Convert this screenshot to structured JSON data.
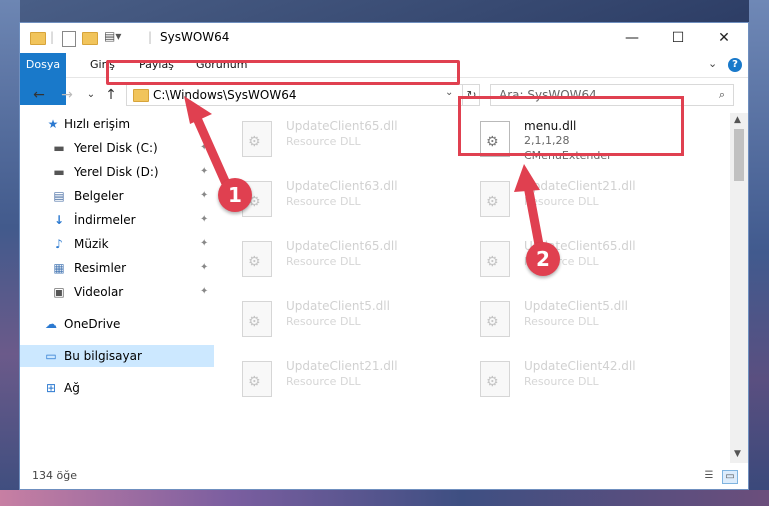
{
  "window": {
    "title": "SysWOW64",
    "qa_divider": "|",
    "controls": {
      "minimize": "—",
      "maximize": "☐",
      "close": "✕"
    }
  },
  "ribbon": {
    "tabs": [
      "Dosya",
      "Giriş",
      "Paylaş",
      "Görünüm"
    ],
    "help": "?",
    "caret": "⌄"
  },
  "nav": {
    "back": "←",
    "forward": "→",
    "recent": "⌄",
    "up": "↑",
    "address": "C:\\Windows\\SysWOW64",
    "address_drop": "⌄",
    "refresh": "↻",
    "search_placeholder": "Ara: SysWOW64",
    "search_icon": "⌕"
  },
  "sidebar": {
    "items": [
      {
        "label": "Hızlı erişim",
        "icon": "★",
        "pinned": false
      },
      {
        "label": "Yerel Disk (C:)",
        "icon": "▬",
        "pinned": true
      },
      {
        "label": "Yerel Disk (D:)",
        "icon": "▬",
        "pinned": true
      },
      {
        "label": "Belgeler",
        "icon": "▤",
        "pinned": true
      },
      {
        "label": "İndirmeler",
        "icon": "↓",
        "pinned": true
      },
      {
        "label": "Müzik",
        "icon": "♪",
        "pinned": true
      },
      {
        "label": "Resimler",
        "icon": "▦",
        "pinned": true
      },
      {
        "label": "Videolar",
        "icon": "▣",
        "pinned": true
      },
      {
        "label": "OneDrive",
        "icon": "☁",
        "pinned": false
      },
      {
        "label": "Bu bilgisayar",
        "icon": "▭",
        "pinned": false
      },
      {
        "label": "Ağ",
        "icon": "⊞",
        "pinned": false
      }
    ],
    "pin_glyph": "📌"
  },
  "files": {
    "left": [
      {
        "name": "UpdateClient65.dll",
        "type": "Resource DLL"
      },
      {
        "name": "UpdateClient63.dll",
        "type": "Resource DLL"
      },
      {
        "name": "UpdateClient65.dll",
        "type": "Resource DLL"
      },
      {
        "name": "UpdateClient5.dll",
        "type": "Resource DLL"
      },
      {
        "name": "UpdateClient21.dll",
        "type": "Resource DLL"
      }
    ],
    "right_target": {
      "name": "menu.dll",
      "version": "2,1,1,28",
      "description": "CMenuExtender"
    },
    "right": [
      {
        "name": "UpdateClient21.dll",
        "type": "Resource DLL"
      },
      {
        "name": "UpdateClient65.dll",
        "type": "Resource DLL"
      },
      {
        "name": "UpdateClient5.dll",
        "type": "Resource DLL"
      },
      {
        "name": "UpdateClient42.dll",
        "type": "Resource DLL"
      }
    ]
  },
  "status": {
    "count": "134 öğe"
  },
  "callouts": {
    "one": "1",
    "two": "2"
  },
  "colors": {
    "accent": "#1979ca",
    "highlight": "#e04050",
    "selected": "#cce8ff"
  }
}
